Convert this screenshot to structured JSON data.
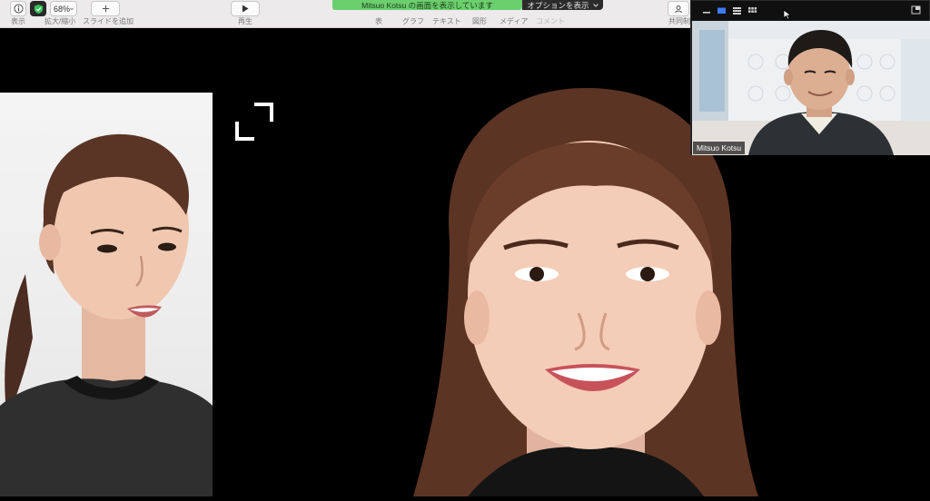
{
  "toolbar": {
    "buttons": [
      {
        "label": "表示",
        "icon": "info-icon"
      },
      {
        "label": "",
        "icon": "shield-check-icon"
      },
      {
        "label": "拡大/縮小",
        "value": "68%",
        "icon": "chevron-down-icon"
      },
      {
        "label": "スライドを追加",
        "icon": "plus-icon"
      },
      {
        "label": "再生",
        "icon": "play-icon"
      },
      {
        "label": "表",
        "icon": "table-icon"
      },
      {
        "label": "グラフ",
        "icon": "chart-icon"
      },
      {
        "label": "テキスト",
        "icon": "text-icon"
      },
      {
        "label": "図形",
        "icon": "shape-icon"
      },
      {
        "label": "メディア",
        "icon": "media-icon"
      },
      {
        "label": "コメント",
        "icon": "comment-icon"
      },
      {
        "label": "共同制",
        "icon": "collaborate-icon"
      }
    ]
  },
  "share_banner": {
    "text": "Mitsuo Kotsu の画面を表示しています",
    "options_label": "オプションを表示"
  },
  "video_panel": {
    "participant_name": "Mitsuo Kotsu",
    "view_icons": [
      "minimize-icon",
      "speaker-view-icon",
      "strip-view-icon",
      "gallery-view-icon"
    ]
  },
  "colors": {
    "banner_green": "#6ccf6d",
    "toolbar_bg": "#eceaea",
    "stage_bg": "#000000",
    "view_active": "#3d7bf0"
  }
}
